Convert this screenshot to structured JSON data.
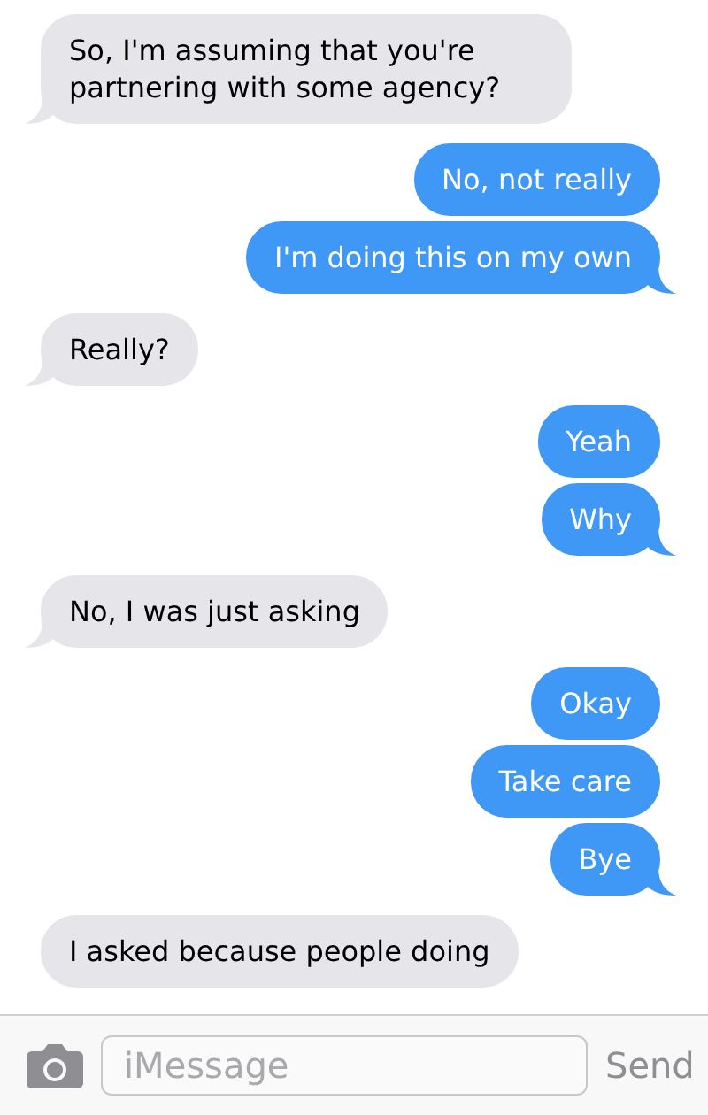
{
  "messages": [
    {
      "kind": "received",
      "text": "So, I'm assuming that you're partnering with some agency?",
      "tail": true
    },
    {
      "kind": "sent",
      "text": "No, not really",
      "tail": false
    },
    {
      "kind": "sent",
      "text": "I'm doing this on my own",
      "tail": true
    },
    {
      "kind": "received",
      "text": "Really?",
      "tail": true
    },
    {
      "kind": "sent",
      "text": "Yeah",
      "tail": false
    },
    {
      "kind": "sent",
      "text": "Why",
      "tail": true
    },
    {
      "kind": "received",
      "text": "No, I was just asking",
      "tail": true
    },
    {
      "kind": "sent",
      "text": "Okay",
      "tail": false
    },
    {
      "kind": "sent",
      "text": "Take care",
      "tail": false
    },
    {
      "kind": "sent",
      "text": "Bye",
      "tail": true
    },
    {
      "kind": "received",
      "text": "I asked because people doing",
      "tail": false
    }
  ],
  "composer": {
    "placeholder": "iMessage",
    "send": "Send"
  }
}
